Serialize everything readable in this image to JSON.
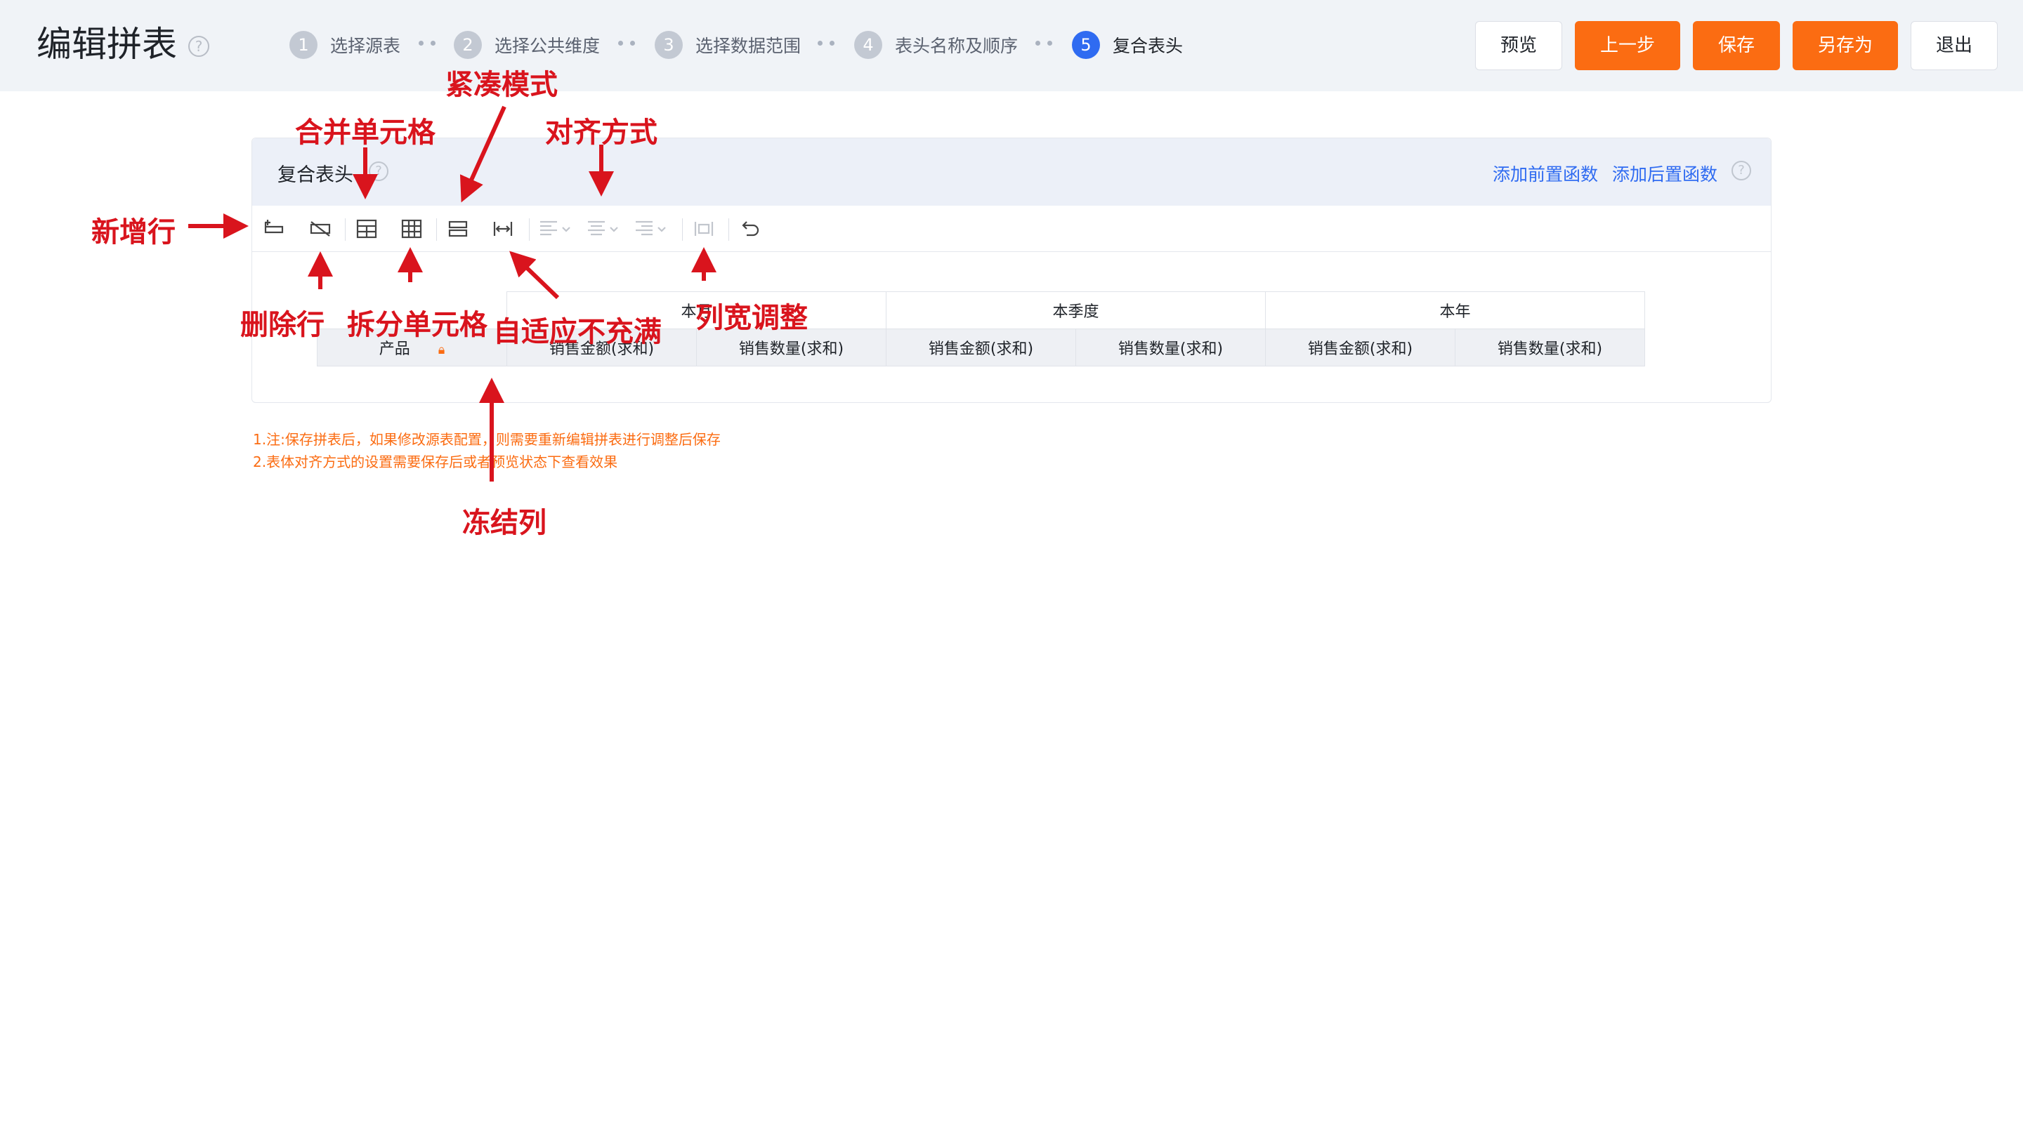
{
  "header": {
    "title": "编辑拼表",
    "steps": [
      {
        "num": "1",
        "label": "选择源表"
      },
      {
        "num": "2",
        "label": "选择公共维度"
      },
      {
        "num": "3",
        "label": "选择数据范围"
      },
      {
        "num": "4",
        "label": "表头名称及顺序"
      },
      {
        "num": "5",
        "label": "复合表头"
      }
    ],
    "buttons": {
      "preview": "预览",
      "prev": "上一步",
      "save": "保存",
      "save_as": "另存为",
      "exit": "退出"
    },
    "accent_color": "#fb6c12",
    "active_step_color": "#2f6bf1"
  },
  "panel": {
    "title": "复合表头",
    "add_pre_func": "添加前置函数",
    "add_post_func": "添加后置函数",
    "toolbar_icons": [
      "add-row-icon",
      "delete-row-icon",
      "merge-cells-icon",
      "split-cells-icon",
      "compact-mode-icon",
      "fit-width-icon",
      "align-left-icon",
      "align-center-icon",
      "align-right-icon",
      "column-width-icon",
      "undo-icon"
    ]
  },
  "table": {
    "row1": [
      "本月",
      "本季度",
      "本年"
    ],
    "row2": [
      "产品",
      "销售金额(求和)",
      "销售数量(求和)",
      "销售金额(求和)",
      "销售数量(求和)",
      "销售金额(求和)",
      "销售数量(求和)"
    ]
  },
  "notes": [
    "1.注:保存拼表后，如果修改源表配置，则需要重新编辑拼表进行调整后保存",
    "2.表体对齐方式的设置需要保存后或者预览状态下查看效果"
  ],
  "annotations": {
    "new_row": "新增行",
    "delete_row": "删除行",
    "merge": "合并单元格",
    "split": "拆分单元格",
    "compact": "紧凑模式",
    "adaptive": "自适应不充满",
    "align": "对齐方式",
    "col_width": "列宽调整",
    "freeze": "冻结列"
  }
}
